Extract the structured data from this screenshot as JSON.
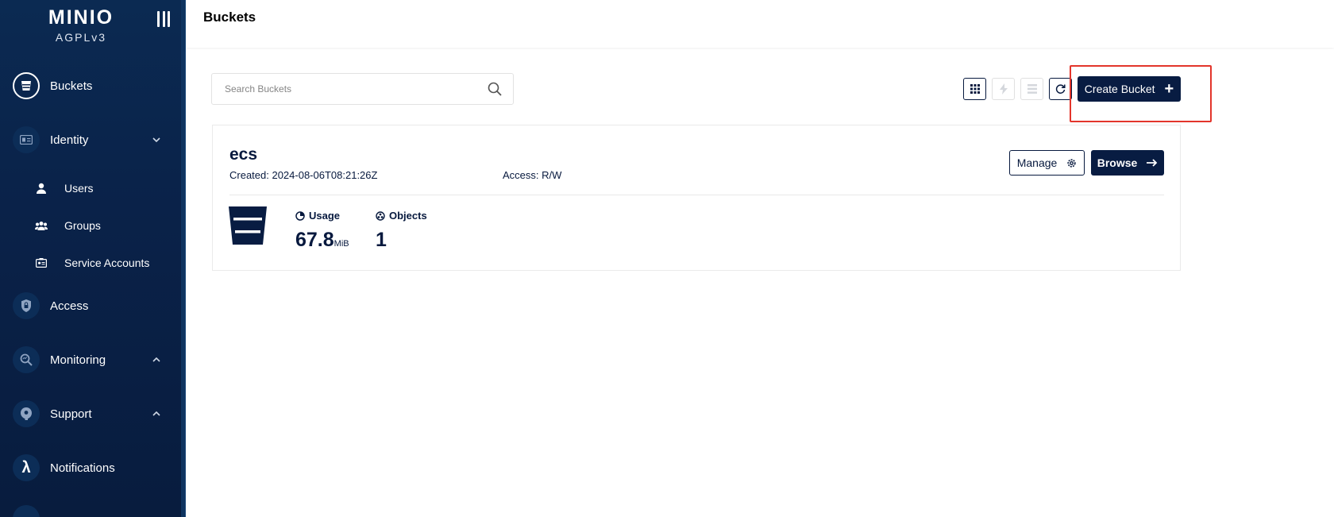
{
  "sidebar": {
    "logo": {
      "main": "MINIO",
      "sub": "AGPLv3"
    },
    "items": [
      {
        "label": "Buckets",
        "icon": "bucket-icon",
        "active": true
      },
      {
        "label": "Identity",
        "icon": "id-card-icon",
        "chevron": "⌄"
      },
      {
        "label": "Users",
        "icon": "user-icon"
      },
      {
        "label": "Groups",
        "icon": "groups-icon"
      },
      {
        "label": "Service Accounts",
        "icon": "service-account-icon"
      },
      {
        "label": "Access",
        "icon": "lock-icon"
      },
      {
        "label": "Monitoring",
        "icon": "magnify-icon",
        "chevron": "⌃"
      },
      {
        "label": "Support",
        "icon": "support-icon",
        "chevron": "⌃"
      },
      {
        "label": "Notifications",
        "icon": "lambda-icon"
      }
    ]
  },
  "header": {
    "title": "Buckets"
  },
  "toolbar": {
    "search_placeholder": "Search Buckets",
    "create_label": "Create Bucket",
    "tool_icons": [
      "grid-icon",
      "lightning-icon",
      "list-icon",
      "refresh-icon"
    ]
  },
  "bucket": {
    "name": "ecs",
    "created": "Created: 2024-08-06T08:21:26Z",
    "access": "Access: R/W",
    "manage_label": "Manage",
    "browse_label": "Browse",
    "usage_label": "Usage",
    "usage_value": "67.8",
    "usage_unit": "MiB",
    "objects_label": "Objects",
    "objects_value": "1"
  },
  "colors": {
    "sidebar": "#0a2249",
    "primary": "#081c42",
    "highlight": "#e3352b"
  }
}
